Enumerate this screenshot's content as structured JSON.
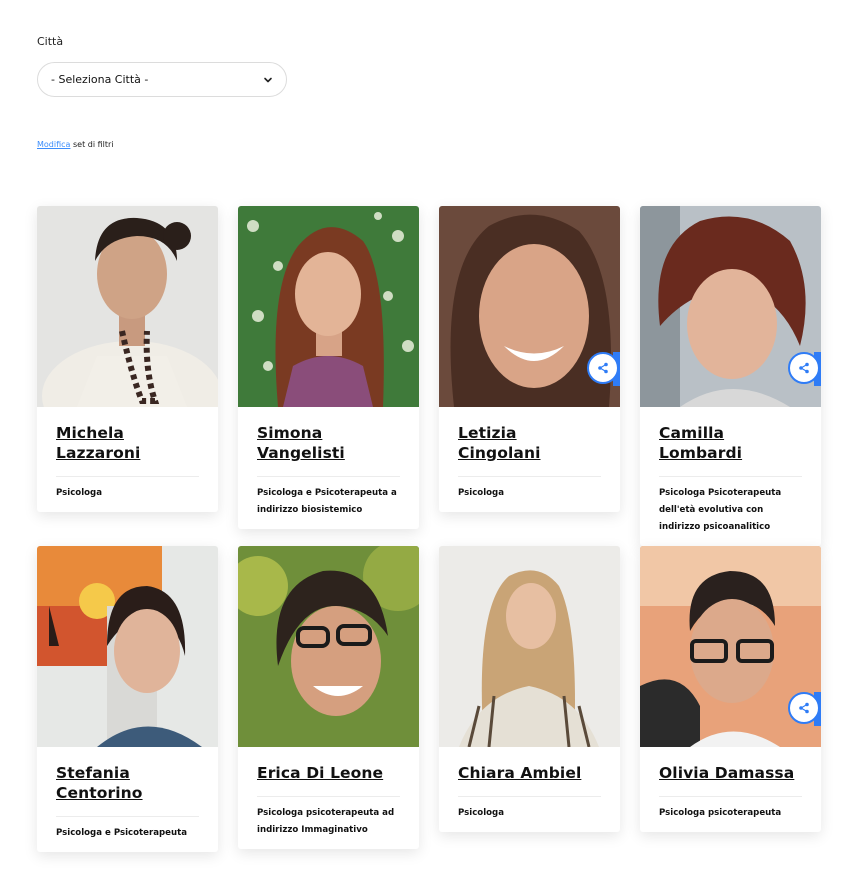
{
  "filter": {
    "label": "Città",
    "select_value": "- Seleziona Città -"
  },
  "modify": {
    "link": "Modifica",
    "suffix": " set di filtri"
  },
  "cards": [
    {
      "name": "Michela Lazzaroni",
      "role": "Psicologa",
      "share": false
    },
    {
      "name": "Simona Vangelisti",
      "role": "Psicologa e Psicoterapeuta a indirizzo biosistemico",
      "share": false
    },
    {
      "name": "Letizia Cingolani",
      "role": "Psicologa",
      "share": true
    },
    {
      "name": "Camilla Lombardi",
      "role": "Psicologa Psicoterapeuta dell'età evolutiva con indirizzo psicoanalitico",
      "share": true
    },
    {
      "name": "Stefania Centorino",
      "role": "Psicologa e Psicoterapeuta",
      "share": false
    },
    {
      "name": "Erica Di Leone",
      "role": "Psicologa psicoterapeuta ad indirizzo Immaginativo",
      "share": false
    },
    {
      "name": "Chiara Ambiel",
      "role": "Psicologa",
      "share": false
    },
    {
      "name": "Olivia Damassa",
      "role": "Psicologa psicoterapeuta",
      "share": true
    }
  ],
  "colors": {
    "accent": "#2f7cf6",
    "link": "#3c8dfb"
  },
  "icons": {
    "select": "chevron-down-icon",
    "share": "share-icon"
  }
}
